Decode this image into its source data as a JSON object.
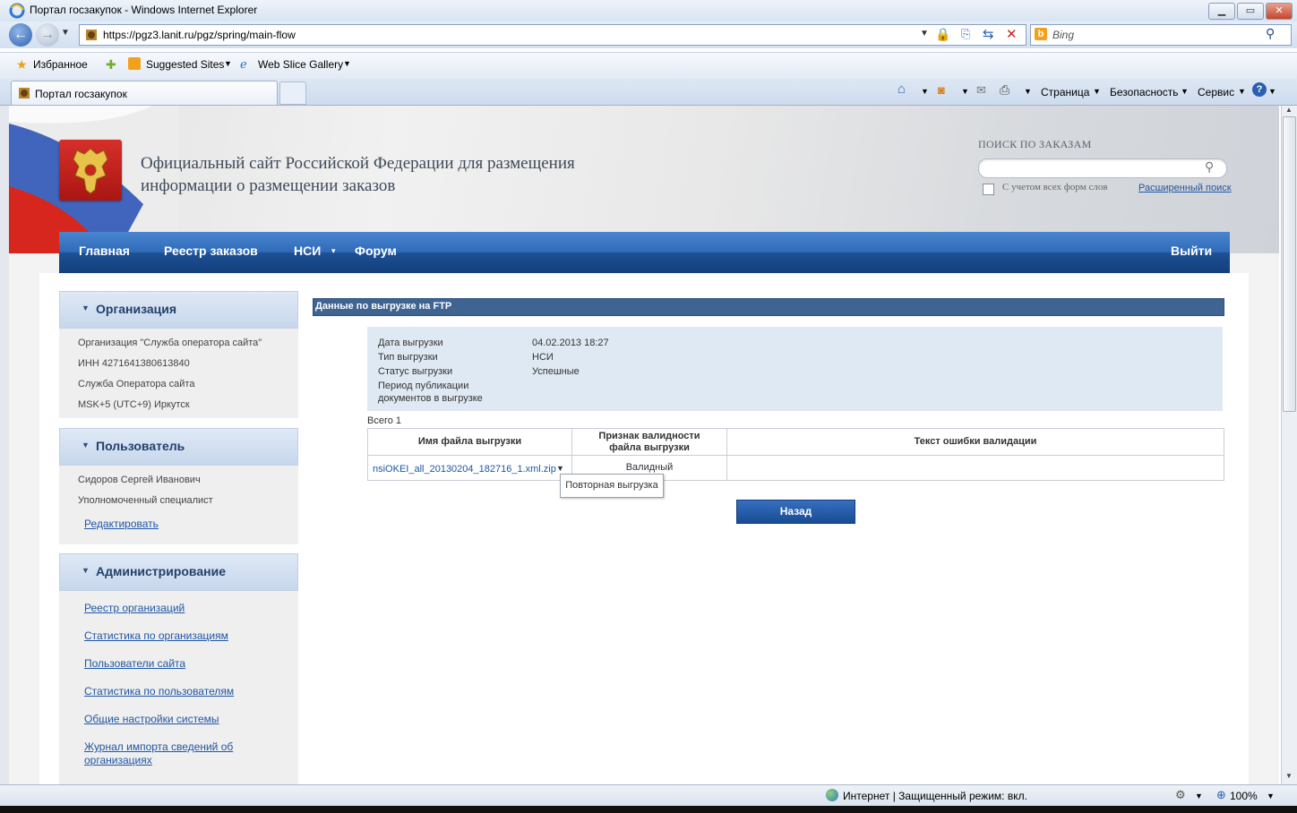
{
  "browser": {
    "window_title": "Портал госзакупок - Windows Internet Explorer",
    "url": "https://pgz3.lanit.ru/pgz/spring/main-flow",
    "search_placeholder": "Bing",
    "favorites_label": "Избранное",
    "fav_items": [
      "Suggested Sites",
      "Web Slice Gallery"
    ],
    "tab_title": "Портал госзакупок",
    "commands": [
      "Страница",
      "Безопасность",
      "Сервис"
    ],
    "status_text": "Интернет | Защищенный режим: вкл.",
    "zoom": "100%"
  },
  "site": {
    "title_line1": "Официальный сайт Российской Федерации для размещения",
    "title_line2": "информации о размещении заказов",
    "search_label": "ПОИСК ПО ЗАКАЗАМ",
    "word_forms_label": "С учетом всех форм слов",
    "advanced_search": "Расширенный поиск"
  },
  "nav": {
    "items": [
      "Главная",
      "Реестр заказов",
      "НСИ",
      "Форум"
    ],
    "logout": "Выйти"
  },
  "sidebar": {
    "org": {
      "title": "Организация",
      "lines": [
        "Организация \"Служба оператора сайта\"",
        "ИНН 4271641380613840",
        "Служба Оператора сайта",
        "MSK+5 (UTC+9) Иркутск"
      ]
    },
    "user": {
      "title": "Пользователь",
      "lines": [
        "Сидоров Сергей Иванович",
        "Уполномоченный специалист"
      ],
      "edit": "Редактировать"
    },
    "admin": {
      "title": "Администрирование",
      "links": [
        "Реестр организаций",
        "Статистика по организациям",
        "Пользователи сайта",
        "Статистика по пользователям",
        "Общие настройки системы"
      ],
      "journal_line1": "Журнал импорта сведений об",
      "journal_line2": "организациях"
    }
  },
  "main": {
    "panel_title": "Данные по выгрузке на FTP",
    "details": {
      "date_label": "Дата выгрузки",
      "date_value": "04.02.2013 18:27",
      "type_label": "Тип выгрузки",
      "type_value": "НСИ",
      "status_label": "Статус выгрузки",
      "status_value": "Успешные",
      "period_label_1": "Период публикации",
      "period_label_2": "документов в выгрузке"
    },
    "total": "Всего 1",
    "table": {
      "col1": "Имя файла выгрузки",
      "col2_line1": "Признак валидности",
      "col2_line2": "файла выгрузки",
      "col3": "Текст ошибки валидации",
      "row_file": "nsiOKEI_all_20130204_182716_1.xml.zip",
      "row_validity": "Валидный",
      "row_error": ""
    },
    "tooltip": "Повторная выгрузка",
    "back_button": "Назад"
  }
}
